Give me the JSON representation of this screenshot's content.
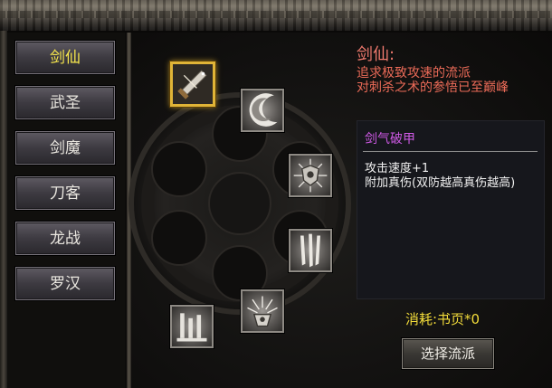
{
  "classes": [
    {
      "label": "剑仙",
      "active": true
    },
    {
      "label": "武圣",
      "active": false
    },
    {
      "label": "剑魔",
      "active": false
    },
    {
      "label": "刀客",
      "active": false
    },
    {
      "label": "龙战",
      "active": false
    },
    {
      "label": "罗汉",
      "active": false
    }
  ],
  "description": {
    "title": "剑仙:",
    "line1": "追求极致攻速的流派",
    "line2": "对刺杀之术的参悟已至巅峰"
  },
  "skill_info": {
    "name": "剑气破甲",
    "effect1": "攻击速度+1",
    "effect2": "附加真伤(双防越高真伤越高)"
  },
  "cost_label": "消耗:书页*0",
  "select_button": "选择流派",
  "skills": [
    {
      "icon": "sword-icon",
      "selected": true
    },
    {
      "icon": "crescent-slash-icon",
      "selected": false
    },
    {
      "icon": "shield-burst-icon",
      "selected": false
    },
    {
      "icon": "claw-strike-icon",
      "selected": false
    },
    {
      "icon": "radiant-emblem-icon",
      "selected": false
    },
    {
      "icon": "fortress-icon",
      "selected": false
    }
  ],
  "colors": {
    "active_class": "#f6e64c",
    "description": "#ec6b58",
    "skill_name": "#cf5ae6",
    "cost": "#f3dc3a",
    "selected_frame": "#e0b437"
  }
}
